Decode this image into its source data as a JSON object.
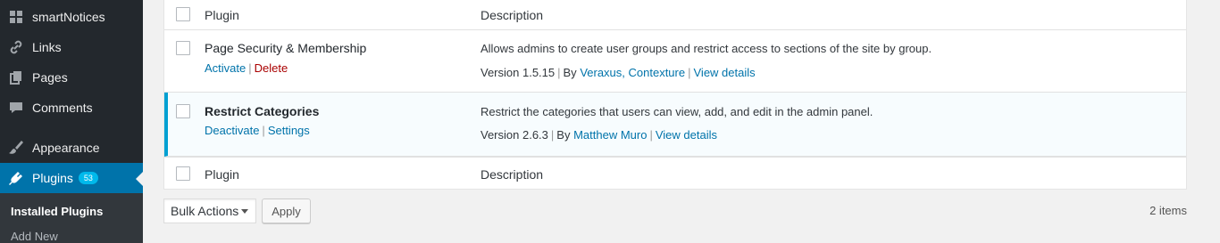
{
  "sidebar": {
    "items": [
      {
        "label": "smartNotices",
        "icon": "dashboard-grid-icon"
      },
      {
        "label": "Links",
        "icon": "link-icon"
      },
      {
        "label": "Pages",
        "icon": "pages-icon"
      },
      {
        "label": "Comments",
        "icon": "comment-bubble-icon"
      },
      {
        "label": "Appearance",
        "icon": "paintbrush-icon"
      },
      {
        "label": "Plugins",
        "icon": "plugin-plug-icon",
        "badge": "53"
      }
    ],
    "submenu": [
      "Installed Plugins",
      "Add New"
    ]
  },
  "table": {
    "header": {
      "plugin": "Plugin",
      "description": "Description"
    },
    "footer": {
      "plugin": "Plugin",
      "description": "Description"
    },
    "rows": [
      {
        "name": "Page Security & Membership",
        "active": false,
        "actions": [
          "Activate",
          "Delete"
        ],
        "description": "Allows admins to create user groups and restrict access to sections of the site by group.",
        "version": "Version 1.5.15",
        "by": "By",
        "authors": "Veraxus, Contexture",
        "details": "View details"
      },
      {
        "name": "Restrict Categories",
        "active": true,
        "actions": [
          "Deactivate",
          "Settings"
        ],
        "description": "Restrict the categories that users can view, add, and edit in the admin panel.",
        "version": "Version 2.6.3",
        "by": "By",
        "authors": "Matthew Muro",
        "details": "View details"
      }
    ]
  },
  "bottom": {
    "bulk_actions": "Bulk Actions",
    "apply": "Apply",
    "count": "2 items"
  },
  "colors": {
    "sidebar_bg": "#23282d",
    "accent": "#0073aa",
    "active_border": "#00a0d2",
    "delete": "#a00"
  }
}
